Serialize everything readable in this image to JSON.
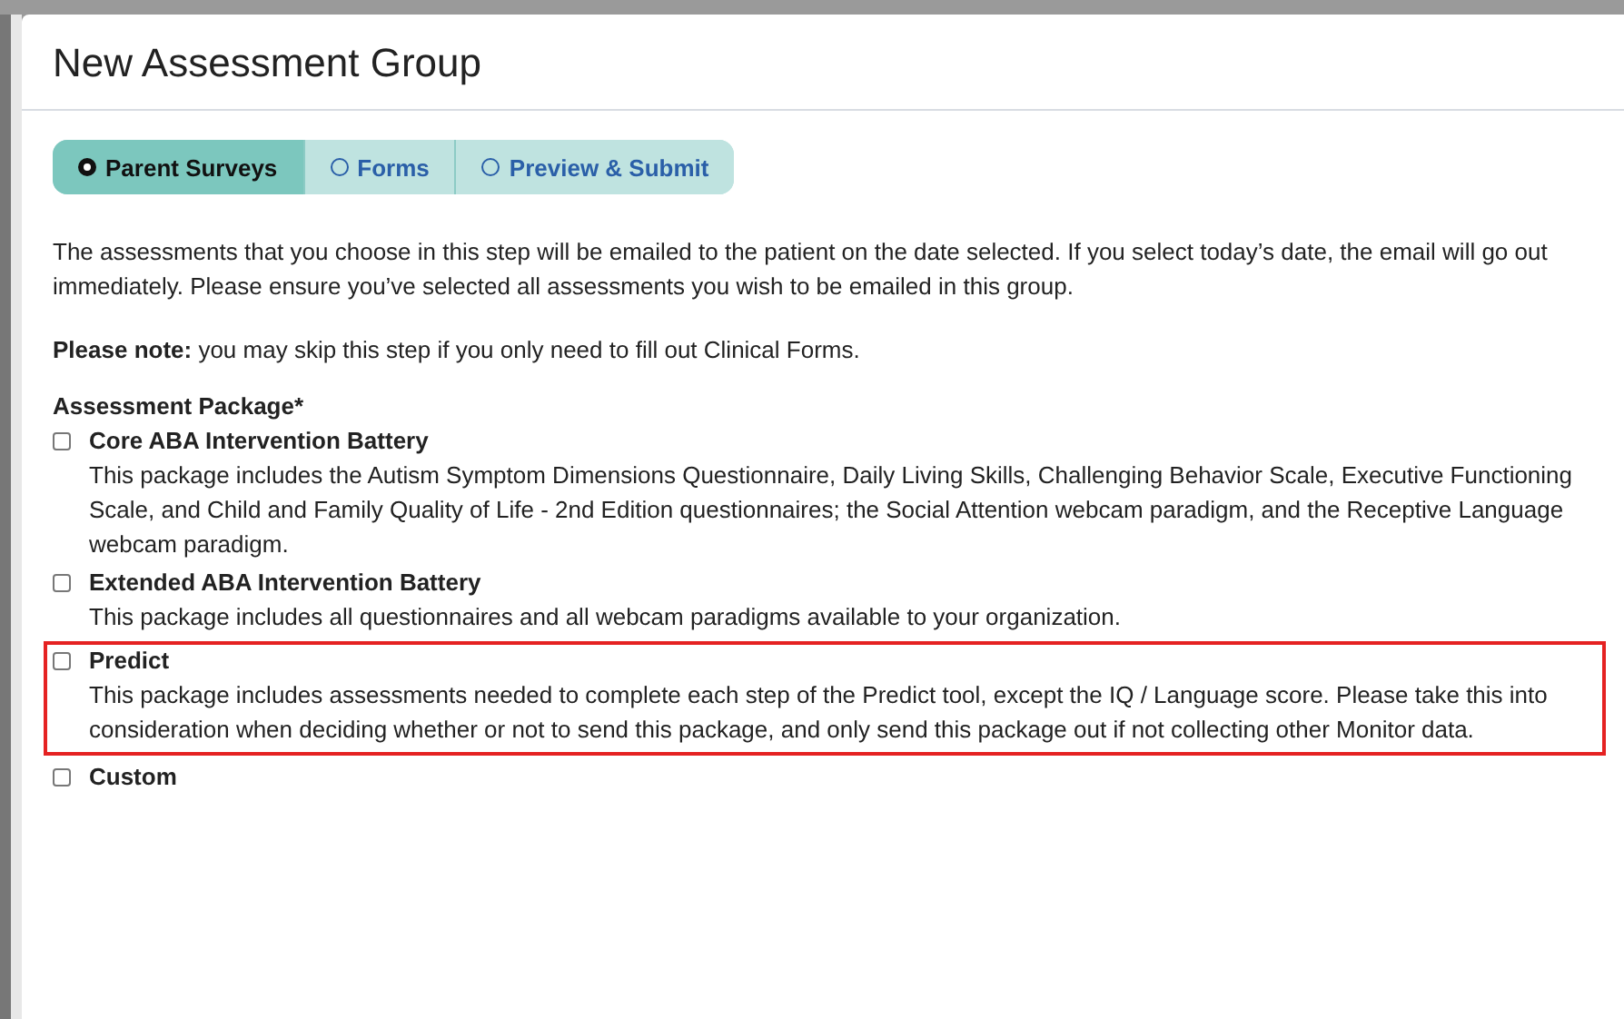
{
  "dialog": {
    "title": "New Assessment Group"
  },
  "steps": [
    {
      "label": "Parent Surveys",
      "selected": true
    },
    {
      "label": "Forms",
      "selected": false
    },
    {
      "label": "Preview & Submit",
      "selected": false
    }
  ],
  "intro": "The assessments that you choose in this step will be emailed to the patient on the date selected. If you select today’s date, the email will go out immediately. Please ensure you’ve selected all assessments you wish to be emailed in this group.",
  "note": "**Please note:** you may skip this step if you only need to fill out Clinical Forms.",
  "package_field": {
    "label": "Assessment Package",
    "required_mark": "*"
  },
  "packages": [
    {
      "name": "Core ABA Intervention Battery",
      "checked": false,
      "highlighted": false,
      "description": "This package includes the Autism Symptom Dimensions Questionnaire, Daily Living Skills, Challenging Behavior Scale, Executive Functioning Scale, and Child and Family Quality of Life - 2nd Edition questionnaires; the Social Attention webcam paradigm, and the Receptive Language webcam paradigm."
    },
    {
      "name": "Extended ABA Intervention Battery",
      "checked": false,
      "highlighted": false,
      "description": "This package includes all questionnaires and all webcam paradigms available to your organization."
    },
    {
      "name": "Predict",
      "checked": false,
      "highlighted": true,
      "description": "This package includes assessments needed to complete each step of the Predict tool, except the IQ / Language score. Please take this into consideration when deciding whether or not to send this package, and only send this package out if not collecting other Monitor data."
    },
    {
      "name": "Custom",
      "checked": false,
      "highlighted": false
    }
  ]
}
